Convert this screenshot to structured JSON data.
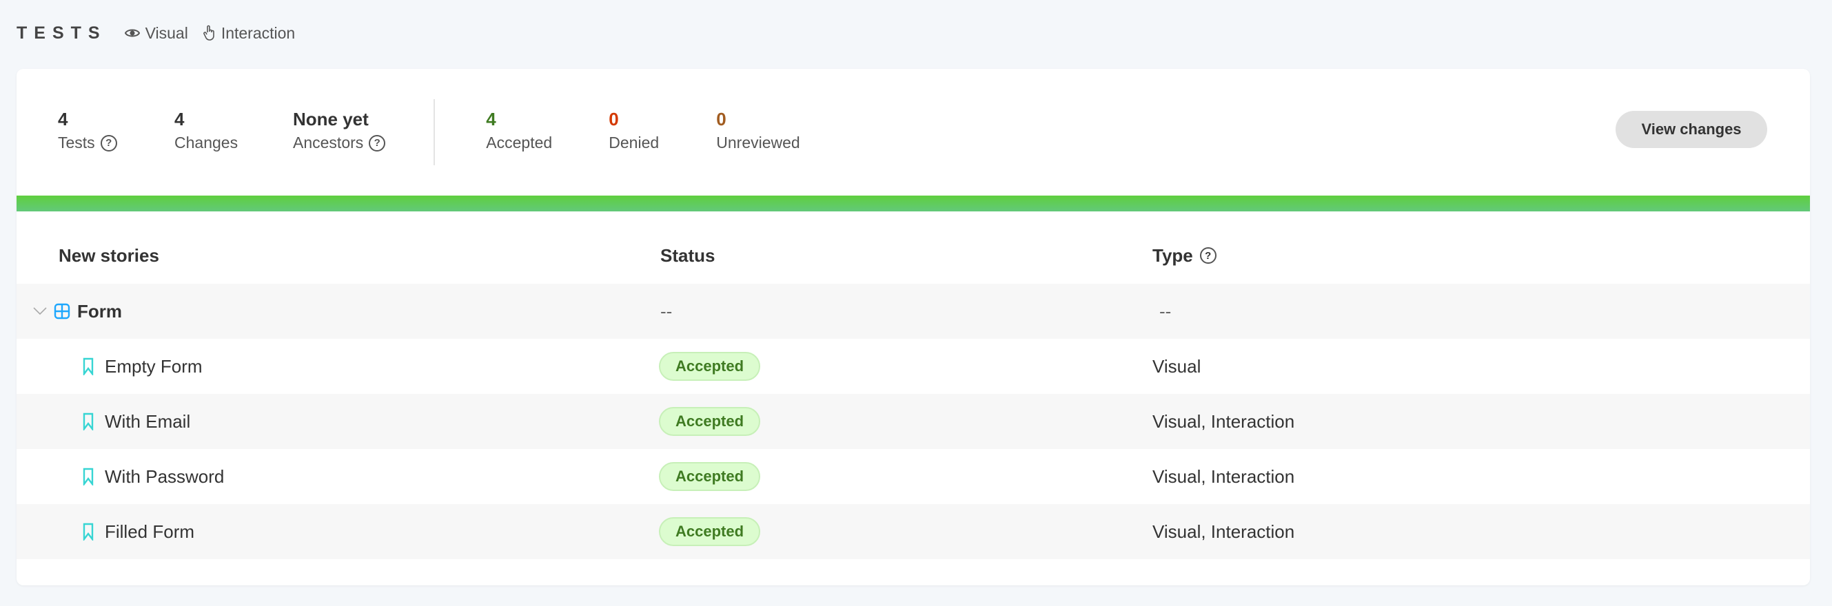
{
  "header": {
    "title": "TESTS",
    "modes": [
      {
        "label": "Visual",
        "icon": "eye-icon"
      },
      {
        "label": "Interaction",
        "icon": "pointer-hand-icon"
      }
    ]
  },
  "stats": [
    {
      "value": "4",
      "label": "Tests",
      "help": true
    },
    {
      "value": "4",
      "label": "Changes"
    },
    {
      "value": "None yet",
      "label": "Ancestors",
      "help": true
    }
  ],
  "review": [
    {
      "value": "4",
      "label": "Accepted",
      "color": "#3f7b22"
    },
    {
      "value": "0",
      "label": "Denied",
      "color": "#d43900"
    },
    {
      "value": "0",
      "label": "Unreviewed",
      "color": "#a15c20"
    }
  ],
  "help_glyph": "?",
  "view_changes": "View changes",
  "progress": {
    "accepted_fraction": 1.0
  },
  "table": {
    "headers": [
      "New stories",
      "Status",
      "Type"
    ],
    "group": {
      "name": "Form",
      "status": "--",
      "type": "--"
    },
    "rows": [
      {
        "name": "Empty Form",
        "status": "Accepted",
        "type": "Visual"
      },
      {
        "name": "With Email",
        "status": "Accepted",
        "type": "Visual, Interaction"
      },
      {
        "name": "With Password",
        "status": "Accepted",
        "type": "Visual, Interaction"
      },
      {
        "name": "Filled Form",
        "status": "Accepted",
        "type": "Visual, Interaction"
      }
    ]
  }
}
